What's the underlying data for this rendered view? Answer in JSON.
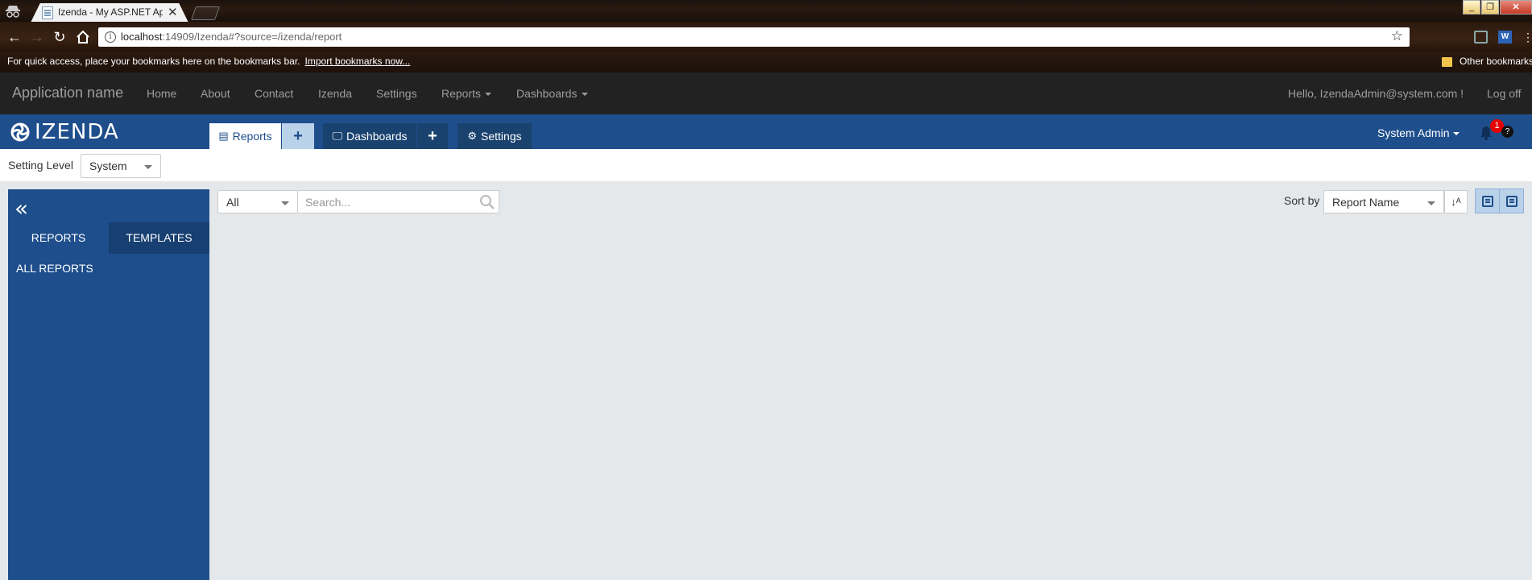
{
  "browser": {
    "tab_title": "Izenda - My ASP.NET Ap",
    "url_host": "localhost",
    "url_rest": ":14909/Izenda#?source=/izenda/report",
    "bookmarks_hint": "For quick access, place your bookmarks here on the bookmarks bar.",
    "import_link": "Import bookmarks now...",
    "other_bookmarks": "Other bookmarks",
    "ext_word": "W"
  },
  "navbar": {
    "brand": "Application name",
    "links": [
      "Home",
      "About",
      "Contact",
      "Izenda",
      "Settings"
    ],
    "reports_label": "Reports",
    "dashboards_label": "Dashboards",
    "greeting": "Hello, IzendaAdmin@system.com !",
    "logoff": "Log off"
  },
  "izenda": {
    "logo_text": "IZENDA",
    "tab_reports": "Reports",
    "tab_dashboards": "Dashboards",
    "tab_settings": "Settings",
    "plus": "+",
    "user": "System Admin",
    "notification_count": "1",
    "help": "?"
  },
  "settings": {
    "level_label": "Setting Level",
    "level_value": "System"
  },
  "sidebar": {
    "collapse_glyph": "«",
    "tab_reports": "REPORTS",
    "tab_templates": "TEMPLATES",
    "all_reports": "ALL REPORTS"
  },
  "filters": {
    "category_value": "All",
    "search_placeholder": "Search...",
    "sort_label": "Sort by",
    "sort_value": "Report Name",
    "sort_dir_glyph": "↓ᴬ"
  },
  "colors": {
    "izenda_blue": "#1e4e8c",
    "navbar": "#222222",
    "content_bg": "#e5e8eb"
  }
}
